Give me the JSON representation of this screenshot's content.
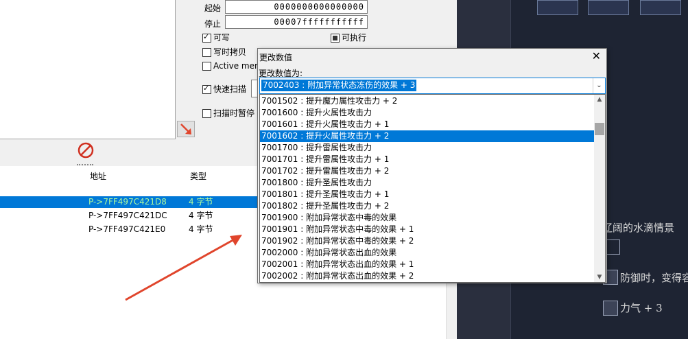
{
  "scan": {
    "start_label": "起始",
    "start_value": "0000000000000000",
    "stop_label": "停止",
    "stop_value": "00007fffffffffff",
    "writable": "可写",
    "executable": "可执行",
    "copy_on_write": "写时拷贝",
    "active_mem": "Active mem",
    "fast_scan": "快速扫描",
    "pause_on_scan": "扫描时暂停"
  },
  "table": {
    "col_address": "地址",
    "col_type": "类型",
    "rows": [
      {
        "address": "P->7FF497C421D8",
        "type": "4 字节",
        "selected": true
      },
      {
        "address": "P->7FF497C421DC",
        "type": "4 字节",
        "selected": false
      },
      {
        "address": "P->7FF497C421E0",
        "type": "4 字节",
        "selected": false
      }
    ]
  },
  "dialog": {
    "title": "更改数值",
    "close": "✕",
    "label": "更改数值为:",
    "current_value": "7002403 : 附加异常状态冻伤的效果 + 3",
    "options": [
      "7001502 : 提升魔力属性攻击力 + 2",
      "7001600 : 提升火属性攻击力",
      "7001601 : 提升火属性攻击力 + 1",
      "7001602 : 提升火属性攻击力 + 2",
      "7001700 : 提升雷属性攻击力",
      "7001701 : 提升雷属性攻击力 + 1",
      "7001702 : 提升雷属性攻击力 + 2",
      "7001800 : 提升圣属性攻击力",
      "7001801 : 提升圣属性攻击力 + 1",
      "7001802 : 提升圣属性攻击力 + 2",
      "7001900 : 附加异常状态中毒的效果",
      "7001901 : 附加异常状态中毒的效果 + 1",
      "7001902 : 附加异常状态中毒的效果 + 2",
      "7002000 : 附加异常状态出血的效果",
      "7002001 : 附加异常状态出血的效果 + 1",
      "7002002 : 附加异常状态出血的效果 + 2"
    ],
    "selected_index": 3
  },
  "game": {
    "text1": "辽阔的水滴情景",
    "text2": "防御时，变得容",
    "text3": "力气 + 3"
  },
  "colors": {
    "selection": "#0078d7",
    "arrow": "#e0452c"
  }
}
